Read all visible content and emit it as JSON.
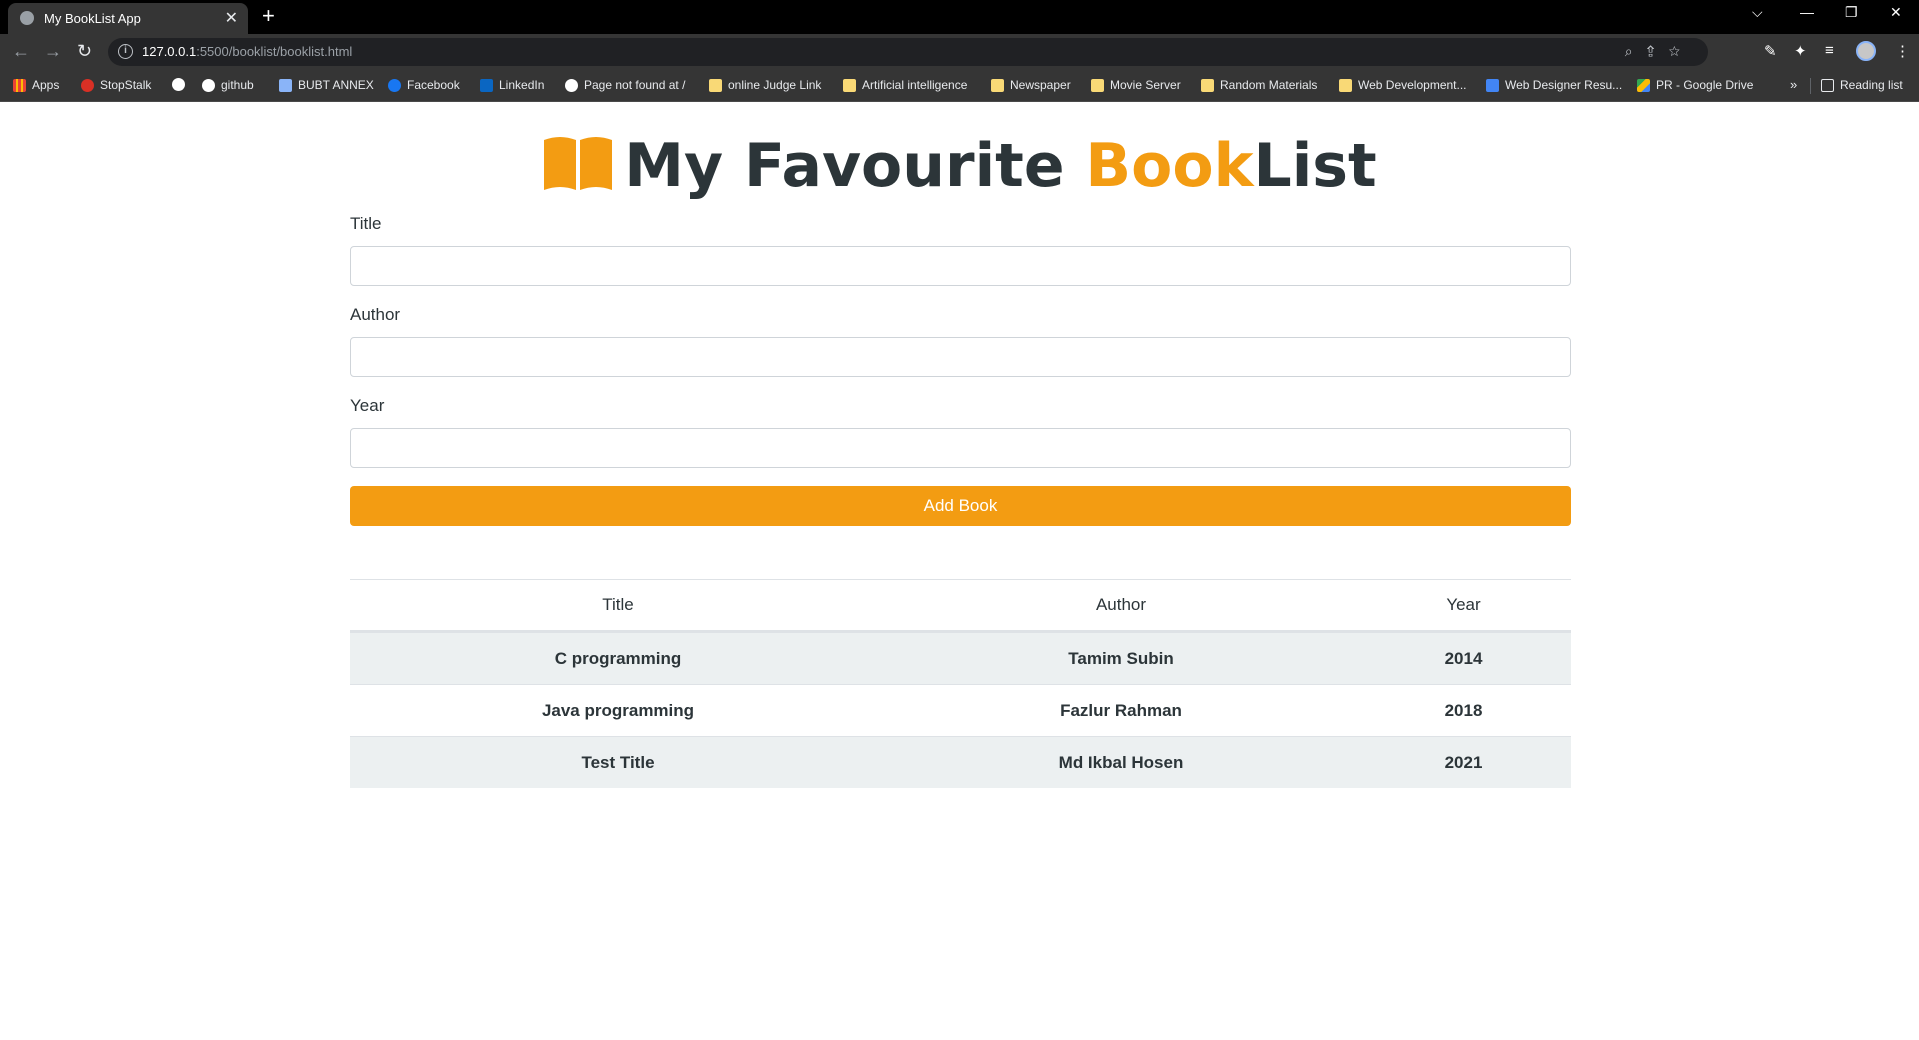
{
  "browser": {
    "tab_title": "My BookList App",
    "url_host": "127.0.0.1",
    "url_path": ":5500/booklist/booklist.html",
    "bookmarks": [
      {
        "label": "Apps",
        "icon": "apps-icon"
      },
      {
        "label": "StopStalk",
        "icon": "stopstalk-icon"
      },
      {
        "label": "",
        "icon": "globe-icon"
      },
      {
        "label": "github",
        "icon": "github-icon"
      },
      {
        "label": "BUBT ANNEX",
        "icon": "bubt-icon"
      },
      {
        "label": "Facebook",
        "icon": "facebook-icon"
      },
      {
        "label": "LinkedIn",
        "icon": "linkedin-icon"
      },
      {
        "label": "Page not found at /",
        "icon": "globe-icon"
      },
      {
        "label": "online Judge Link",
        "icon": "folder-icon"
      },
      {
        "label": "Artificial intelligence",
        "icon": "folder-icon"
      },
      {
        "label": "Newspaper",
        "icon": "folder-icon"
      },
      {
        "label": "Movie Server",
        "icon": "folder-icon"
      },
      {
        "label": "Random Materials",
        "icon": "folder-icon"
      },
      {
        "label": "Web Development...",
        "icon": "folder-icon"
      },
      {
        "label": "Web Designer Resu...",
        "icon": "bookmark-icon"
      },
      {
        "label": "PR - Google Drive",
        "icon": "google-drive-icon"
      }
    ],
    "more_label": "»",
    "reading_list_label": "Reading list"
  },
  "header": {
    "title_part1": "My Favourite ",
    "title_accent": "Book",
    "title_part2": "List",
    "accent_color": "#f39c12"
  },
  "form": {
    "title_label": "Title",
    "author_label": "Author",
    "year_label": "Year",
    "title_value": "",
    "author_value": "",
    "year_value": "",
    "submit_label": "Add Book"
  },
  "table": {
    "columns": [
      "Title",
      "Author",
      "Year"
    ],
    "rows": [
      [
        "C programming",
        "Tamim Subin",
        "2014"
      ],
      [
        "Java programming",
        "Fazlur Rahman",
        "2018"
      ],
      [
        "Test Title",
        "Md Ikbal Hosen",
        "2021"
      ]
    ]
  }
}
